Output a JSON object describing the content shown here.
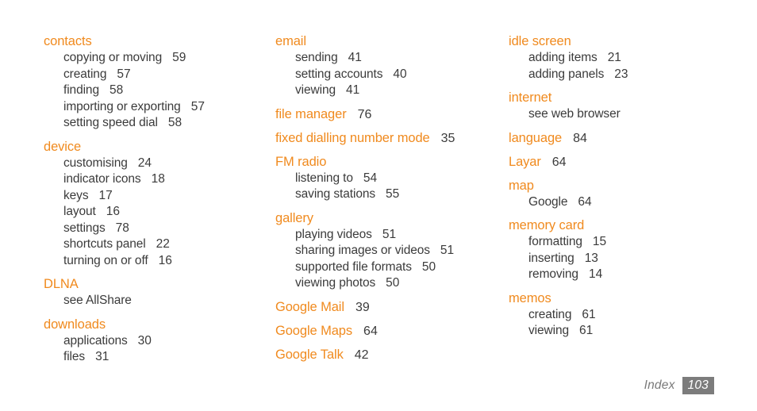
{
  "document": {
    "type": "index-page",
    "colors": {
      "heading": "#F08A1E",
      "body": "#3B3B3B",
      "footer_text": "#7A7A7A",
      "footer_badge_bg": "#7C7C7C",
      "footer_badge_text": "#FFFFFF",
      "background": "#FFFFFF"
    }
  },
  "footer": {
    "label": "Index",
    "page_number": "103"
  },
  "columns": [
    {
      "id": "column-1",
      "groups": [
        {
          "heading": "contacts",
          "heading_page": "",
          "entries": [
            {
              "label": "copying or moving",
              "page": "59"
            },
            {
              "label": "creating",
              "page": "57"
            },
            {
              "label": "finding",
              "page": "58"
            },
            {
              "label": "importing or exporting",
              "page": "57"
            },
            {
              "label": "setting speed dial",
              "page": "58"
            }
          ]
        },
        {
          "heading": "device",
          "heading_page": "",
          "entries": [
            {
              "label": "customising",
              "page": "24"
            },
            {
              "label": "indicator icons",
              "page": "18"
            },
            {
              "label": "keys",
              "page": "17"
            },
            {
              "label": "layout",
              "page": "16"
            },
            {
              "label": "settings",
              "page": "78"
            },
            {
              "label": "shortcuts panel",
              "page": "22"
            },
            {
              "label": "turning on or off",
              "page": "16"
            }
          ]
        },
        {
          "heading": "DLNA",
          "heading_page": "",
          "entries": [
            {
              "label": "see AllShare",
              "page": ""
            }
          ]
        },
        {
          "heading": "downloads",
          "heading_page": "",
          "entries": [
            {
              "label": "applications",
              "page": "30"
            },
            {
              "label": "files",
              "page": "31"
            }
          ]
        }
      ]
    },
    {
      "id": "column-2",
      "groups": [
        {
          "heading": "email",
          "heading_page": "",
          "entries": [
            {
              "label": "sending",
              "page": "41"
            },
            {
              "label": "setting accounts",
              "page": "40"
            },
            {
              "label": "viewing",
              "page": "41"
            }
          ]
        },
        {
          "heading": "file manager",
          "heading_page": "76",
          "entries": []
        },
        {
          "heading": "fixed dialling number mode",
          "heading_page": "35",
          "entries": []
        },
        {
          "heading": "FM radio",
          "heading_page": "",
          "entries": [
            {
              "label": "listening to",
              "page": "54"
            },
            {
              "label": "saving stations",
              "page": "55"
            }
          ]
        },
        {
          "heading": "gallery",
          "heading_page": "",
          "entries": [
            {
              "label": "playing videos",
              "page": "51"
            },
            {
              "label": "sharing images or videos",
              "page": "51"
            },
            {
              "label": "supported file formats",
              "page": "50"
            },
            {
              "label": "viewing photos",
              "page": "50"
            }
          ]
        },
        {
          "heading": "Google Mail",
          "heading_page": "39",
          "entries": []
        },
        {
          "heading": "Google Maps",
          "heading_page": "64",
          "entries": []
        },
        {
          "heading": "Google Talk",
          "heading_page": "42",
          "entries": []
        }
      ]
    },
    {
      "id": "column-3",
      "groups": [
        {
          "heading": "idle screen",
          "heading_page": "",
          "entries": [
            {
              "label": "adding items",
              "page": "21"
            },
            {
              "label": "adding panels",
              "page": "23"
            }
          ]
        },
        {
          "heading": "internet",
          "heading_page": "",
          "entries": [
            {
              "label": "see web browser",
              "page": ""
            }
          ]
        },
        {
          "heading": "language",
          "heading_page": "84",
          "entries": []
        },
        {
          "heading": "Layar",
          "heading_page": "64",
          "entries": []
        },
        {
          "heading": "map",
          "heading_page": "",
          "entries": [
            {
              "label": "Google",
              "page": "64"
            }
          ]
        },
        {
          "heading": "memory card",
          "heading_page": "",
          "entries": [
            {
              "label": "formatting",
              "page": "15"
            },
            {
              "label": "inserting",
              "page": "13"
            },
            {
              "label": "removing",
              "page": "14"
            }
          ]
        },
        {
          "heading": "memos",
          "heading_page": "",
          "entries": [
            {
              "label": "creating",
              "page": "61"
            },
            {
              "label": "viewing",
              "page": "61"
            }
          ]
        }
      ]
    }
  ]
}
